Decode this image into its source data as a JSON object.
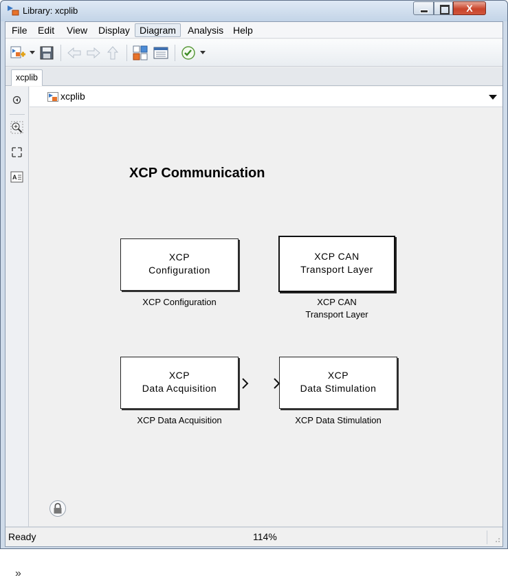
{
  "window": {
    "title": "Library: xcplib",
    "close_glyph": "X"
  },
  "menu": [
    {
      "label": "File"
    },
    {
      "label": "Edit"
    },
    {
      "label": "View"
    },
    {
      "label": "Display"
    },
    {
      "label": "Diagram"
    },
    {
      "label": "Analysis"
    },
    {
      "label": "Help"
    }
  ],
  "toolbar": {
    "icons": [
      "new-model-icon",
      "save-icon",
      "back-arrow-icon",
      "forward-arrow-icon",
      "up-arrow-icon",
      "library-browser-icon",
      "model-explorer-icon",
      "check-icon"
    ]
  },
  "tab": {
    "label": "xcplib"
  },
  "address": {
    "path": "xcplib"
  },
  "diagram": {
    "title": "XCP Communication",
    "blocks": [
      {
        "line1": "XCP",
        "line2": "Configuration",
        "caption1": "XCP Configuration",
        "caption2": ""
      },
      {
        "line1": "XCP CAN",
        "line2": "Transport Layer",
        "caption1": "XCP CAN",
        "caption2": "Transport Layer"
      },
      {
        "line1": "XCP",
        "line2": "Data Acquisition",
        "caption1": "XCP Data Acquisition",
        "caption2": ""
      },
      {
        "line1": "XCP",
        "line2": "Data Stimulation",
        "caption1": "XCP Data Stimulation",
        "caption2": ""
      }
    ]
  },
  "left_strip": {
    "expand_glyph": "»"
  },
  "status": {
    "text": "Ready",
    "zoom": "114%"
  },
  "colors": {
    "title_bar": "#cfdbe9",
    "canvas": "#f0f0f0",
    "close_button": "#c9452c"
  }
}
